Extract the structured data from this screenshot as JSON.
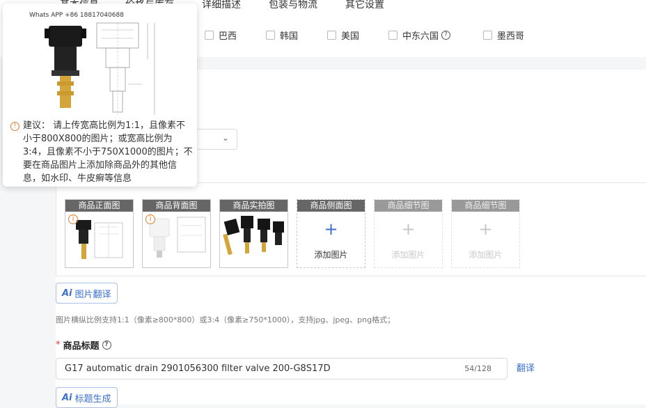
{
  "tabs": [
    "基本信息",
    "价格与库存",
    "详细描述",
    "包装与物流",
    "其它设置"
  ],
  "countries": [
    {
      "label": "巴西",
      "checked": false
    },
    {
      "label": "韩国",
      "checked": false
    },
    {
      "label": "美国",
      "checked": false
    },
    {
      "label": "中东六国",
      "checked": false,
      "help": true
    },
    {
      "label": "墨西哥",
      "checked": false
    }
  ],
  "tooltip": {
    "watermark": "Whats APP +86 18817040688",
    "text": "建议： 请上传宽高比例为1:1，且像素不小于800X800的图片；或宽高比例为3:4，且像素不小于750X1000的图片；不要在商品图片上添加除商品外的其他信息，如水印、牛皮癣等信息"
  },
  "image_slots": [
    {
      "label": "商品正面图",
      "state": "filled",
      "warning": true
    },
    {
      "label": "商品背面图",
      "state": "filled",
      "warning": true
    },
    {
      "label": "商品实拍图",
      "state": "filled",
      "warning": false
    },
    {
      "label": "商品侧面图",
      "state": "empty",
      "add_label": "添加图片"
    },
    {
      "label": "商品细节图",
      "state": "disabled",
      "add_label": "添加图片"
    },
    {
      "label": "商品细节图",
      "state": "disabled",
      "add_label": "添加图片"
    }
  ],
  "image_translate_button": {
    "ai": "Ai",
    "label": "图片翻译"
  },
  "image_hint": "图片横纵比例支持1:1（像素≥800*800）或3:4（像素≥750*1000），支持jpg、jpeg、png格式；",
  "title_field": {
    "required_mark": "*",
    "label": "商品标题",
    "value": "G17 automatic drain 2901056300 filter valve 200-G8S17D",
    "counter": "54/128",
    "translate_link": "翻译"
  },
  "title_generate_button": {
    "ai": "Ai",
    "label": "标题生成"
  },
  "colors": {
    "accent": "#3b6fd0",
    "warning": "#e07b2a",
    "required": "#e03c3c"
  }
}
